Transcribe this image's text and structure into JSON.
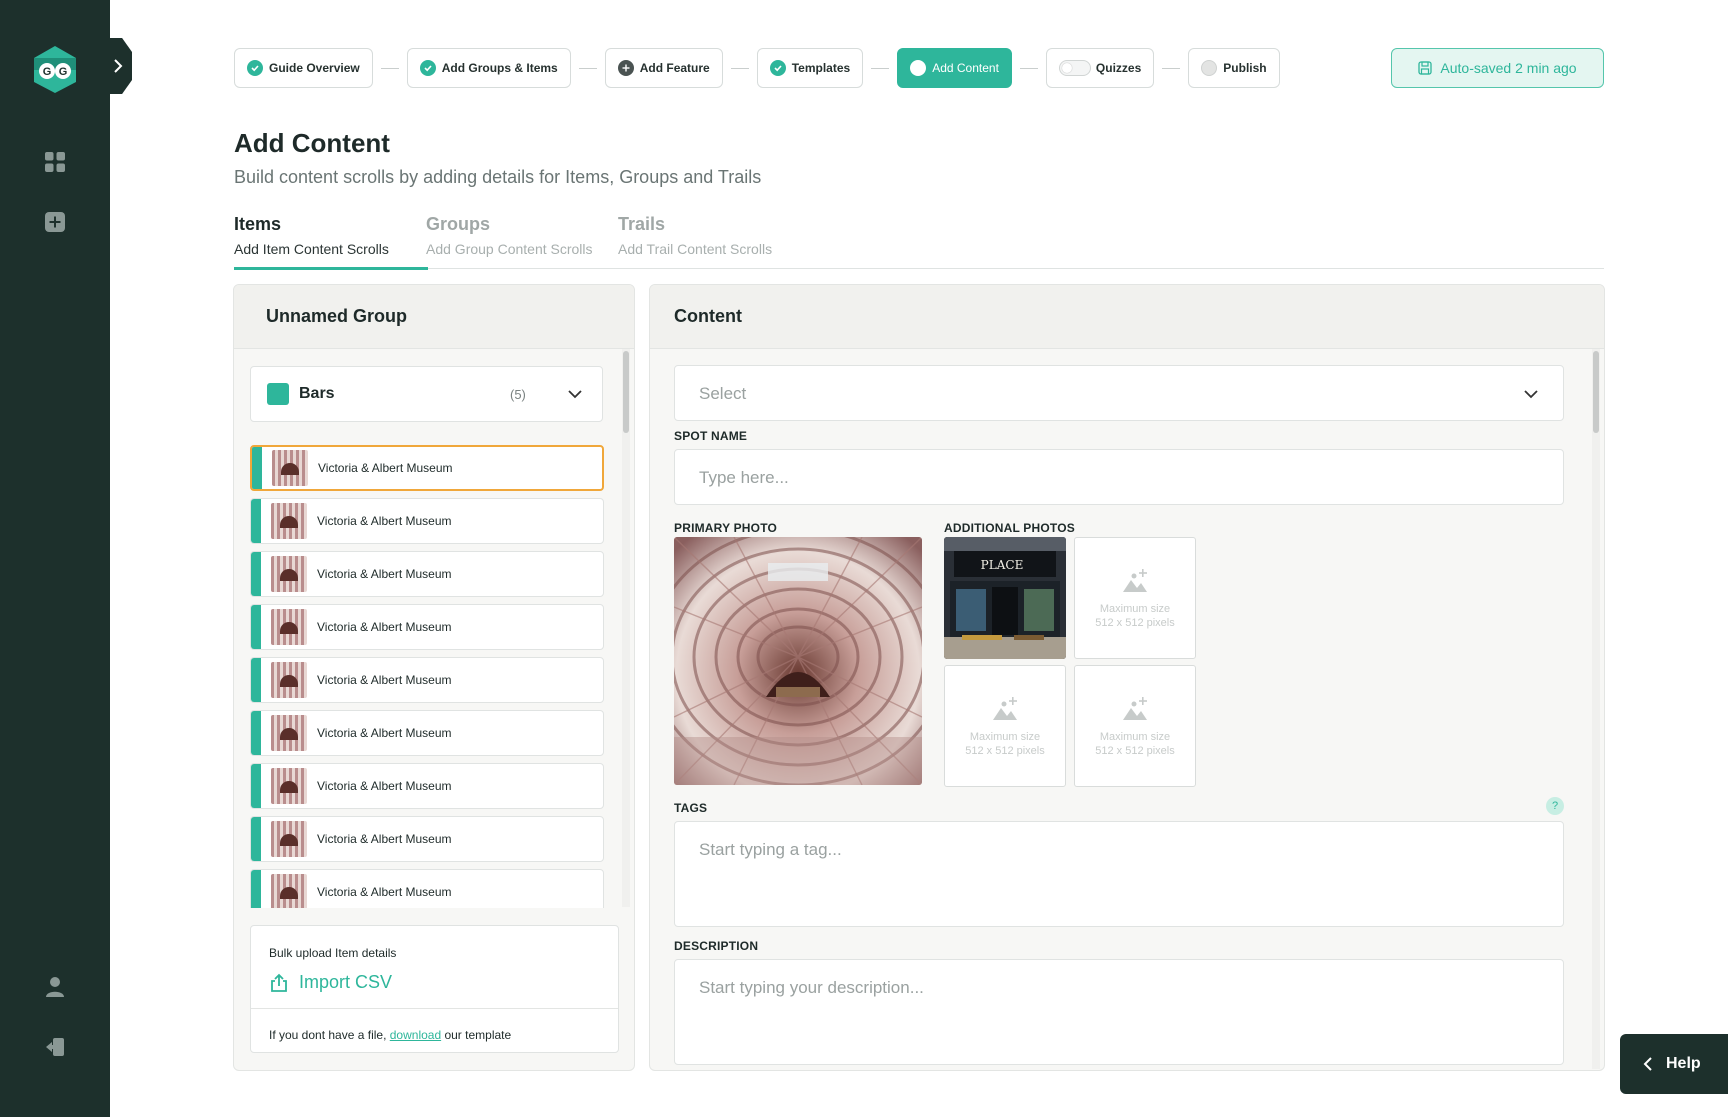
{
  "app": {
    "logo_text": "GG"
  },
  "stepper": {
    "steps": [
      {
        "label": "Guide Overview",
        "state": "done"
      },
      {
        "label": "Add Groups & Items",
        "state": "done"
      },
      {
        "label": "Add Feature",
        "state": "add"
      },
      {
        "label": "Templates",
        "state": "done"
      },
      {
        "label": "Add Content",
        "state": "active"
      },
      {
        "label": "Quizzes",
        "state": "toggle"
      },
      {
        "label": "Publish",
        "state": "pending"
      }
    ],
    "autosave_label": "Auto-saved 2 min ago"
  },
  "page": {
    "title": "Add Content",
    "subtitle": "Build content scrolls by adding details for Items, Groups and Trails"
  },
  "tabs": [
    {
      "title": "Items",
      "subtitle": "Add Item Content Scrolls",
      "active": true
    },
    {
      "title": "Groups",
      "subtitle": "Add Group Content Scrolls",
      "active": false
    },
    {
      "title": "Trails",
      "subtitle": "Add Trail Content Scrolls",
      "active": false
    }
  ],
  "left_panel": {
    "title": "Unnamed Group",
    "group": {
      "name": "Bars",
      "count": "(5)",
      "color": "#2eb69b"
    },
    "items": [
      "Victoria & Albert Museum",
      "Victoria & Albert Museum",
      "Victoria & Albert Museum",
      "Victoria & Albert Museum",
      "Victoria & Albert Museum",
      "Victoria & Albert Museum",
      "Victoria & Albert Museum",
      "Victoria & Albert Museum",
      "Victoria & Albert Museum"
    ],
    "csv": {
      "title": "Bulk upload Item details",
      "button_label": "Import CSV",
      "footer_prefix": "If you dont have a file, ",
      "footer_link": "download",
      "footer_suffix": " our template"
    }
  },
  "right_panel": {
    "title": "Content",
    "select_placeholder": "Select",
    "spot_name_label": "SPOT NAME",
    "spot_name_placeholder": "Type here...",
    "primary_photo_label": "PRIMARY PHOTO",
    "additional_photos_label": "ADDITIONAL PHOTOS",
    "photo_slot_caption_1": "Maximum size",
    "photo_slot_caption_2": "512 x 512 pixels",
    "place_sign": "PLACE",
    "tags_label": "TAGS",
    "tags_placeholder": "Start typing a tag...",
    "tags_help": "?",
    "description_label": "DESCRIPTION",
    "description_placeholder": "Start typing your description..."
  },
  "help": {
    "label": "Help"
  },
  "colors": {
    "accent": "#2eb69b",
    "sidebar": "#1d302c",
    "selected_outline": "#f0a73a"
  }
}
